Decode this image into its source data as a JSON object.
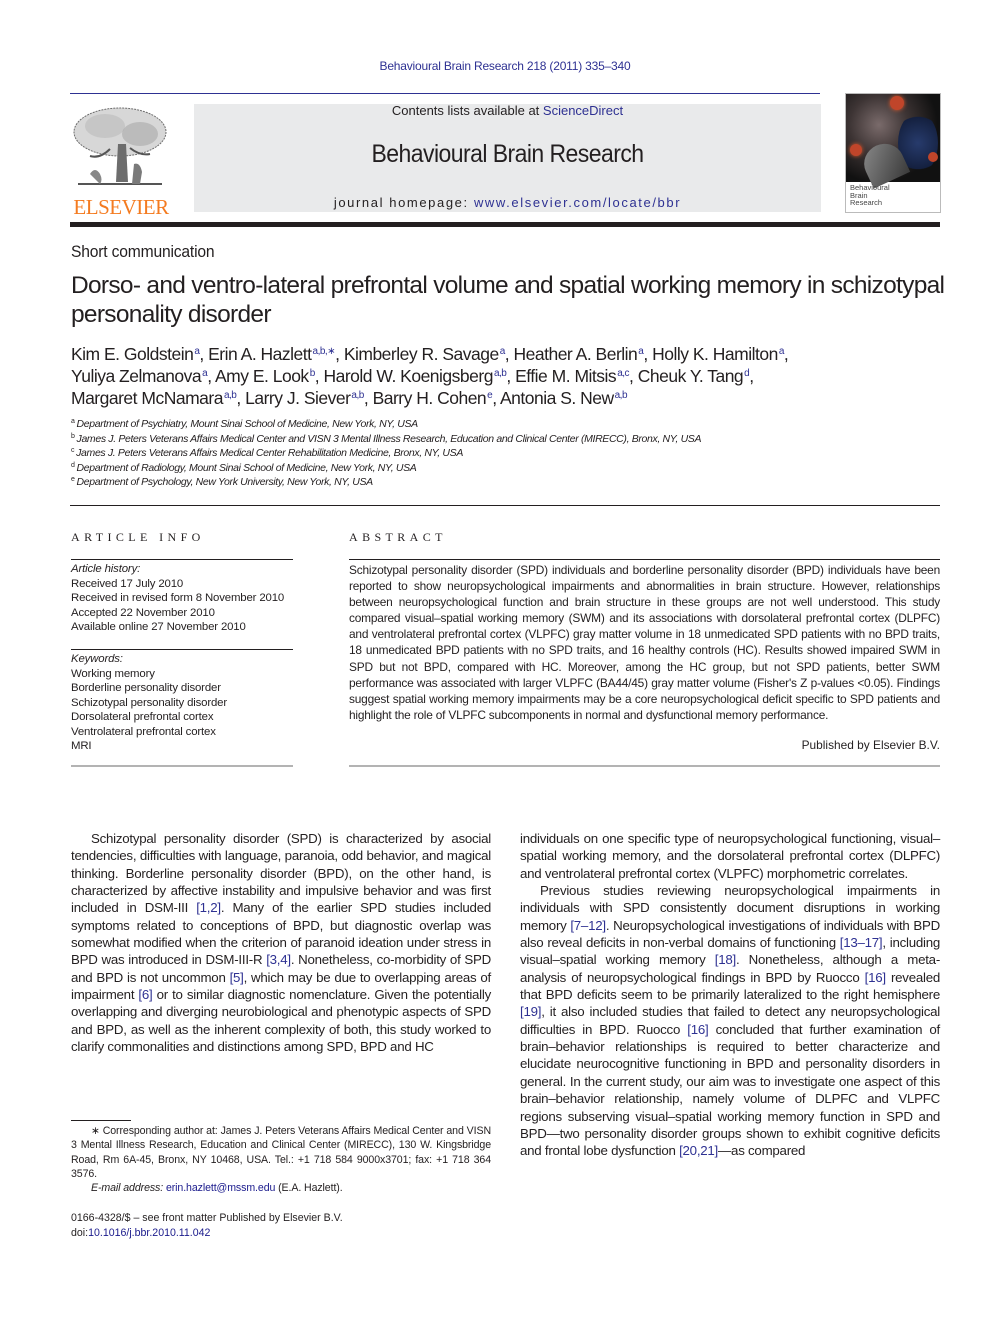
{
  "header": {
    "citation": "Behavioural Brain Research 218 (2011) 335–340",
    "contents_prefix": "Contents lists available at ",
    "contents_link": "ScienceDirect",
    "journal_title": "Behavioural Brain Research",
    "homepage_prefix": "journal homepage: ",
    "homepage_url": "www.elsevier.com/locate/bbr",
    "publisher_logo_text": "ELSEVIER",
    "cover_title_lines": [
      "Behavioural",
      "Brain",
      "Research"
    ]
  },
  "article": {
    "type": "Short communication",
    "title": "Dorso- and ventro-lateral prefrontal volume and spatial working memory in schizotypal personality disorder",
    "authors": [
      {
        "name": "Kim E. Goldstein",
        "aff": "a"
      },
      {
        "name": "Erin A. Hazlett",
        "aff": "a,b,∗"
      },
      {
        "name": "Kimberley R. Savage",
        "aff": "a"
      },
      {
        "name": "Heather A. Berlin",
        "aff": "a"
      },
      {
        "name": "Holly K. Hamilton",
        "aff": "a"
      },
      {
        "name": "Yuliya Zelmanova",
        "aff": "a"
      },
      {
        "name": "Amy E. Look",
        "aff": "b"
      },
      {
        "name": "Harold W. Koenigsberg",
        "aff": "a,b"
      },
      {
        "name": "Effie M. Mitsis",
        "aff": "a,c"
      },
      {
        "name": "Cheuk Y. Tang",
        "aff": "d"
      },
      {
        "name": "Margaret McNamara",
        "aff": "a,b"
      },
      {
        "name": "Larry J. Siever",
        "aff": "a,b"
      },
      {
        "name": "Barry H. Cohen",
        "aff": "e"
      },
      {
        "name": "Antonia S. New",
        "aff": "a,b"
      }
    ],
    "affiliations": [
      {
        "key": "a",
        "text": "Department of Psychiatry, Mount Sinai School of Medicine, New York, NY, USA"
      },
      {
        "key": "b",
        "text": "James J. Peters Veterans Affairs Medical Center and VISN 3 Mental Illness Research, Education and Clinical Center (MIRECC), Bronx, NY, USA"
      },
      {
        "key": "c",
        "text": "James J. Peters Veterans Affairs Medical Center Rehabilitation Medicine, Bronx, NY, USA"
      },
      {
        "key": "d",
        "text": "Department of Radiology, Mount Sinai School of Medicine, New York, NY, USA"
      },
      {
        "key": "e",
        "text": "Department of Psychology, New York University, New York, NY, USA"
      }
    ]
  },
  "article_info": {
    "heading": "ARTICLE INFO",
    "history_label": "Article history:",
    "history": [
      "Received 17 July 2010",
      "Received in revised form 8 November 2010",
      "Accepted 22 November 2010",
      "Available online 27 November 2010"
    ],
    "keywords_label": "Keywords:",
    "keywords": [
      "Working memory",
      "Borderline personality disorder",
      "Schizotypal personality disorder",
      "Dorsolateral prefrontal cortex",
      "Ventrolateral prefrontal cortex",
      "MRI"
    ]
  },
  "abstract": {
    "heading": "ABSTRACT",
    "text": "Schizotypal personality disorder (SPD) individuals and borderline personality disorder (BPD) individuals have been reported to show neuropsychological impairments and abnormalities in brain structure. However, relationships between neuropsychological function and brain structure in these groups are not well understood. This study compared visual–spatial working memory (SWM) and its associations with dorsolateral prefrontal cortex (DLPFC) and ventrolateral prefrontal cortex (VLPFC) gray matter volume in 18 unmedicated SPD patients with no BPD traits, 18 unmedicated BPD patients with no SPD traits, and 16 healthy controls (HC). Results showed impaired SWM in SPD but not BPD, compared with HC. Moreover, among the HC group, but not SPD patients, better SWM performance was associated with larger VLPFC (BA44/45) gray matter volume (Fisher's Z p-values <0.05). Findings suggest spatial working memory impairments may be a core neuropsychological deficit specific to SPD patients and highlight the role of VLPFC subcomponents in normal and dysfunctional memory performance.",
    "published_by": "Published by Elsevier B.V."
  },
  "body": {
    "left_column": [
      [
        {
          "t": "Schizotypal personality disorder (SPD) is characterized by asocial tendencies, difficulties with language, paranoia, odd behavior, and magical thinking. Borderline personality disorder (BPD), on the other hand, is characterized by affective instability and impulsive behavior and was first included in DSM-III "
        },
        {
          "ref": "[1,2]"
        },
        {
          "t": ". Many of the earlier SPD studies included symptoms related to conceptions of BPD, but diagnostic overlap was somewhat modified when the criterion of paranoid ideation under stress in BPD was introduced in DSM-III-R "
        },
        {
          "ref": "[3,4]"
        },
        {
          "t": ". Nonetheless, co-morbidity of SPD and BPD is not uncommon "
        },
        {
          "ref": "[5]"
        },
        {
          "t": ", which may be due to overlapping areas of impairment "
        },
        {
          "ref": "[6]"
        },
        {
          "t": " or to similar diagnostic nomenclature. Given the potentially overlapping and diverging neurobiological and phenotypic aspects of SPD and BPD, as well as the inherent complexity of both, this study worked to clarify commonalities and distinctions among SPD, BPD and HC"
        }
      ]
    ],
    "right_column": [
      [
        {
          "t": "individuals on one specific type of neuropsychological functioning, visual–spatial working memory, and the dorsolateral prefrontal cortex (DLPFC) and ventrolateral prefrontal cortex (VLPFC) morphometric correlates."
        }
      ],
      [
        {
          "t": "Previous studies reviewing neuropsychological impairments in individuals with SPD consistently document disruptions in working memory "
        },
        {
          "ref": "[7–12]"
        },
        {
          "t": ". Neuropsychological investigations of individuals with BPD also reveal deficits in non-verbal domains of functioning "
        },
        {
          "ref": "[13–17]"
        },
        {
          "t": ", including visual–spatial working memory "
        },
        {
          "ref": "[18]"
        },
        {
          "t": ". Nonetheless, although a meta-analysis of neuropsychological findings in BPD by Ruocco "
        },
        {
          "ref": "[16]"
        },
        {
          "t": " revealed that BPD deficits seem to be primarily lateralized to the right hemisphere "
        },
        {
          "ref": "[19]"
        },
        {
          "t": ", it also included studies that failed to detect any neuropsychological difficulties in BPD. Ruocco "
        },
        {
          "ref": "[16]"
        },
        {
          "t": " concluded that further examination of brain–behavior relationships is required to better characterize and elucidate neurocognitive functioning in BPD and personality disorders in general. In the current study, our aim was to investigate one aspect of this brain–behavior relationship, namely volume of DLPFC and VLPFC regions subserving visual–spatial working memory function in SPD and BPD—two personality disorder groups shown to exhibit cognitive deficits and frontal lobe dysfunction "
        },
        {
          "ref": "[20,21]"
        },
        {
          "t": "—as compared"
        }
      ]
    ]
  },
  "footnotes": {
    "corresponding": "∗ Corresponding author at: James J. Peters Veterans Affairs Medical Center and VISN 3 Mental Illness Research, Education and Clinical Center (MIRECC), 130 W. Kingsbridge Road, Rm 6A-45, Bronx, NY 10468, USA. Tel.: +1 718 584 9000x3701; fax: +1 718 364 3576.",
    "email_label": "E-mail address: ",
    "email": "erin.hazlett@mssm.edu",
    "email_suffix": " (E.A. Hazlett).",
    "issn_line": "0166-4328/$ – see front matter Published by Elsevier B.V.",
    "doi_prefix": "doi:",
    "doi": "10.1016/j.bbr.2010.11.042"
  }
}
